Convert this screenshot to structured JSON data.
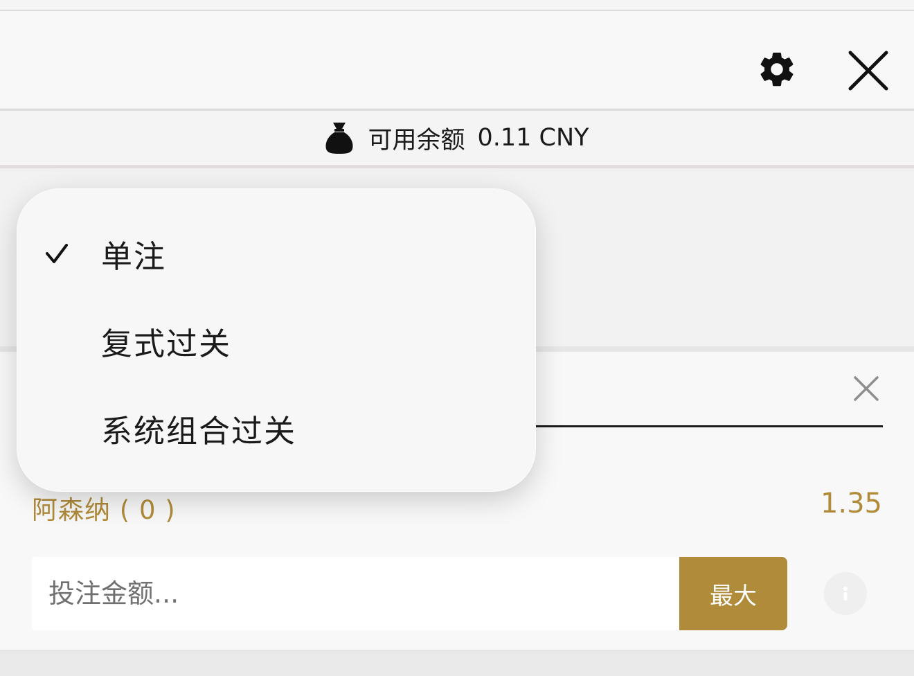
{
  "header": {
    "settings_icon": "gear-icon",
    "close_icon": "close-icon"
  },
  "balance": {
    "icon": "money-bag-icon",
    "label": "可用余额",
    "amount": "0.11 CNY"
  },
  "bet_type_menu": {
    "items": [
      {
        "label": "单注",
        "selected": true
      },
      {
        "label": "复式过关",
        "selected": false
      },
      {
        "label": "系统组合过关",
        "selected": false
      }
    ]
  },
  "bet": {
    "remove_icon": "close-icon",
    "selection": "阿森纳 ( 0 )",
    "odds": "1.35",
    "stake_placeholder": "投注金额...",
    "max_label": "最大",
    "info_icon": "info-icon"
  },
  "colors": {
    "accent": "#b08b3a",
    "background": "#f1f0f0",
    "text": "#1a1a1a"
  }
}
